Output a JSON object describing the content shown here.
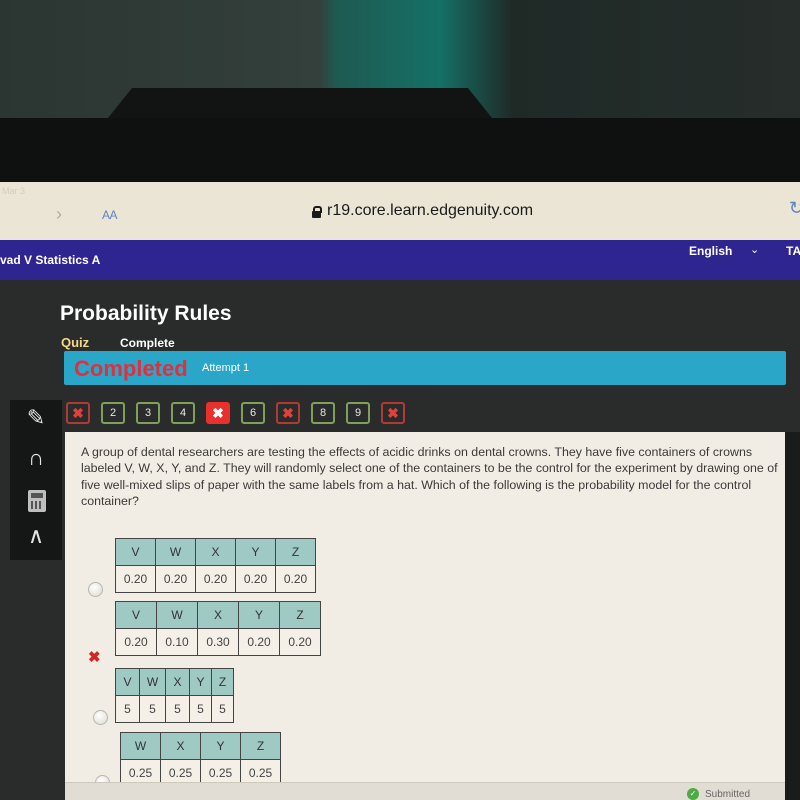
{
  "status_bar": {
    "date": "Mar 3"
  },
  "browser": {
    "text_size_label": "AA",
    "url": "r19.core.learn.edgenuity.com",
    "forward_icon": "chevron-right-icon",
    "reload_icon": "reload-icon"
  },
  "course_bar": {
    "course_title": "vad V Statistics A",
    "language": "English",
    "truncated_right": "TA"
  },
  "header": {
    "title": "Probability Rules",
    "activity_type": "Quiz",
    "activity_status": "Complete"
  },
  "status": {
    "completed_label": "Completed",
    "attempt_label": "Attempt 1"
  },
  "question_nav": [
    {
      "label": "✖",
      "state": "wrong"
    },
    {
      "label": "2",
      "state": "correct"
    },
    {
      "label": "3",
      "state": "correct"
    },
    {
      "label": "4",
      "state": "correct"
    },
    {
      "label": "✖",
      "state": "current-wrong"
    },
    {
      "label": "6",
      "state": "correct"
    },
    {
      "label": "✖",
      "state": "wrong"
    },
    {
      "label": "8",
      "state": "correct"
    },
    {
      "label": "9",
      "state": "correct"
    },
    {
      "label": "✖",
      "state": "wrong"
    }
  ],
  "tools": [
    "pencil-icon",
    "headphones-icon",
    "calculator-icon",
    "collapse-icon"
  ],
  "question": {
    "text": "A group of dental researchers are testing the effects of acidic drinks on dental crowns. They have five containers of crowns labeled V, W, X, Y, and Z. They will randomly select one of the containers to be the control for the experiment by drawing one of five well-mixed slips of paper with the same labels from a hat. Which of the following is the probability model for the control container?",
    "options": [
      {
        "headers": [
          "V",
          "W",
          "X",
          "Y",
          "Z"
        ],
        "values": [
          "0.20",
          "0.20",
          "0.20",
          "0.20",
          "0.20"
        ],
        "marker": "radio"
      },
      {
        "headers": [
          "V",
          "W",
          "X",
          "Y",
          "Z"
        ],
        "values": [
          "0.20",
          "0.10",
          "0.30",
          "0.20",
          "0.20"
        ],
        "marker": "incorrect-x"
      },
      {
        "headers": [
          "V",
          "W",
          "X",
          "Y",
          "Z"
        ],
        "values": [
          "5",
          "5",
          "5",
          "5",
          "5"
        ],
        "marker": "radio"
      },
      {
        "headers": [
          "W",
          "X",
          "Y",
          "Z"
        ],
        "values": [
          "0.25",
          "0.25",
          "0.25",
          "0.25"
        ],
        "marker": "radio"
      }
    ]
  },
  "footer": {
    "submitted_label": "Submitted"
  },
  "colors": {
    "course_bar": "#2f2590",
    "status_bar": "#2aa6c9",
    "completed_text": "#e0303e",
    "correct_border": "#7ea05a",
    "wrong": "#e8302c",
    "table_header": "#9fc9c3"
  }
}
